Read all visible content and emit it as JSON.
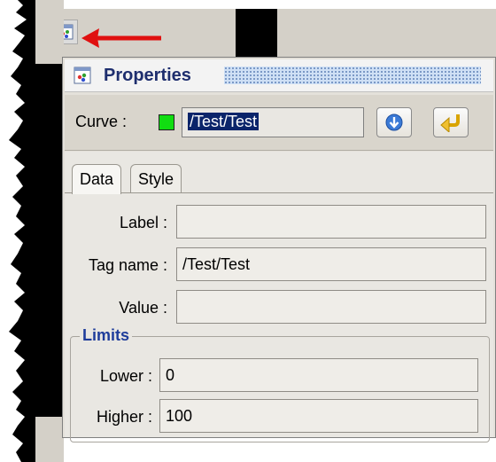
{
  "properties_panel": {
    "title": "Properties",
    "curve_label": "Curve :",
    "curve_value": "/Test/Test",
    "curve_color": "#11dd11",
    "tabs": [
      {
        "label": "Data",
        "active": true
      },
      {
        "label": "Style",
        "active": false
      }
    ],
    "fields": {
      "label": {
        "label": "Label :",
        "value": ""
      },
      "tag_name": {
        "label": "Tag name :",
        "value": "/Test/Test"
      },
      "value": {
        "label": "Value :",
        "value": ""
      }
    },
    "limits": {
      "title": "Limits",
      "lower": {
        "label": "Lower :",
        "value": "0"
      },
      "higher": {
        "label": "Higher :",
        "value": "100"
      }
    },
    "icons": {
      "toolbar_button": "properties-icon",
      "title_icon": "properties-icon",
      "down_button": "arrow-down-icon",
      "apply_button": "return-arrow-icon",
      "callout": "red-arrow-icon"
    },
    "colors": {
      "title_text": "#1e2e6e",
      "limits_title": "#1f3d9b",
      "selection": "#0a246a",
      "callout_arrow": "#e01010"
    }
  }
}
